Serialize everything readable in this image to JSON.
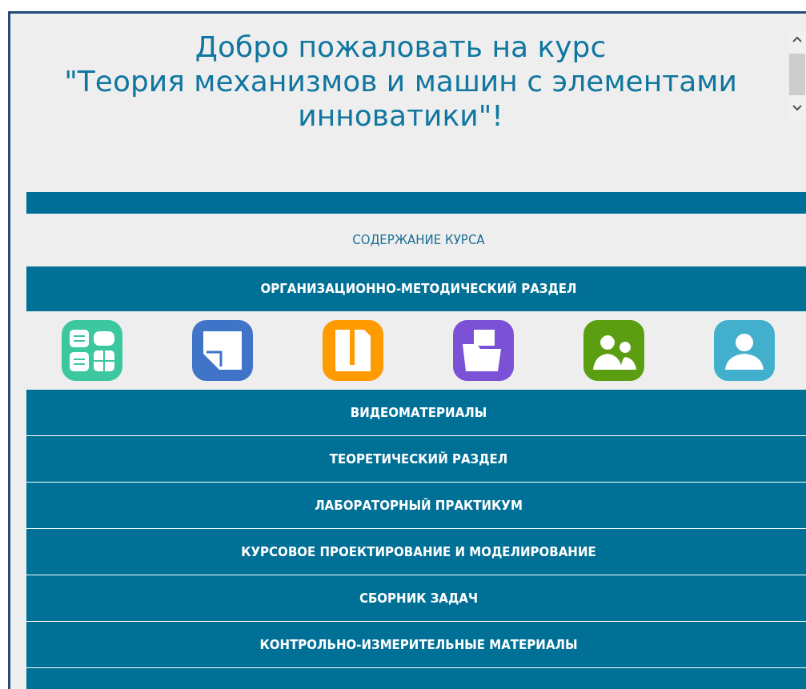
{
  "title_lines": [
    "Добро пожаловать на курс",
    "\"Теория механизмов и машин с элементами",
    "инноватики\"!"
  ],
  "contents_heading": "СОДЕРЖАНИЕ КУРСА",
  "top_section": "ОРГАНИЗАЦИОННО-МЕТОДИЧЕСКИЙ РАЗДЕЛ",
  "icons": [
    {
      "kind": "calculator"
    },
    {
      "kind": "note"
    },
    {
      "kind": "archive"
    },
    {
      "kind": "folder"
    },
    {
      "kind": "group"
    },
    {
      "kind": "person"
    }
  ],
  "sections": [
    "ВИДЕОМАТЕРИАЛЫ",
    "ТЕОРЕТИЧЕСКИЙ РАЗДЕЛ",
    "ЛАБОРАТОРНЫЙ ПРАКТИКУМ",
    "КУРСОВОЕ ПРОЕКТИРОВАНИЕ И МОДЕЛИРОВАНИЕ",
    "СБОРНИК ЗАДАЧ",
    "КОНТРОЛЬНО-ИЗМЕРИТЕЛЬНЫЕ МАТЕРИАЛЫ"
  ]
}
